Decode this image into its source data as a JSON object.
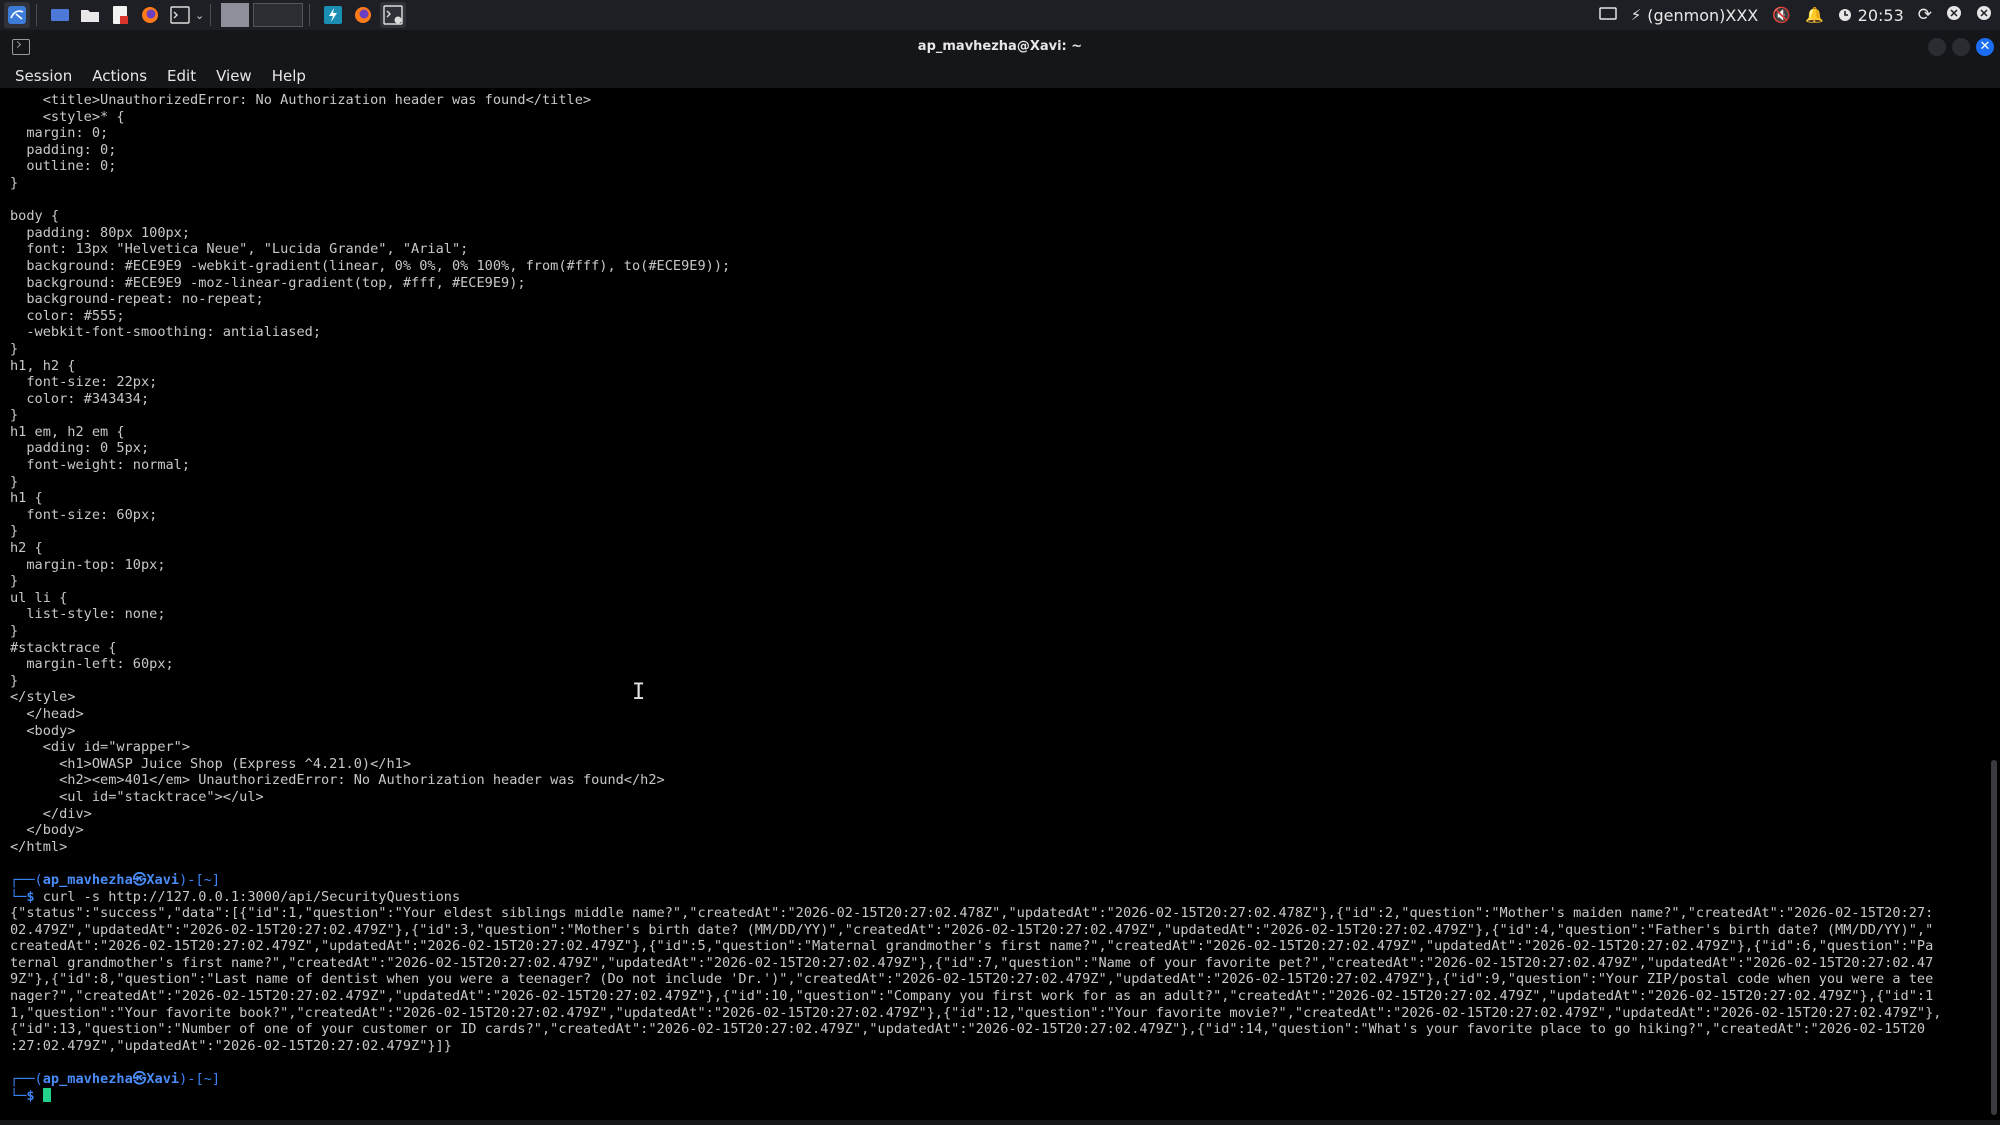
{
  "panel": {
    "status_label": "(genmon)XXX",
    "clock": "20:53"
  },
  "window": {
    "title": "ap_mavhezha@Xavi: ~"
  },
  "menu": [
    "Session",
    "Actions",
    "Edit",
    "View",
    "Help"
  ],
  "terminal": {
    "lines_before": [
      "    <title>UnauthorizedError: No Authorization header was found</title>",
      "    <style>* {",
      "  margin: 0;",
      "  padding: 0;",
      "  outline: 0;",
      "}",
      "",
      "body {",
      "  padding: 80px 100px;",
      "  font: 13px \"Helvetica Neue\", \"Lucida Grande\", \"Arial\";",
      "  background: #ECE9E9 -webkit-gradient(linear, 0% 0%, 0% 100%, from(#fff), to(#ECE9E9));",
      "  background: #ECE9E9 -moz-linear-gradient(top, #fff, #ECE9E9);",
      "  background-repeat: no-repeat;",
      "  color: #555;",
      "  -webkit-font-smoothing: antialiased;",
      "}",
      "h1, h2 {",
      "  font-size: 22px;",
      "  color: #343434;",
      "}",
      "h1 em, h2 em {",
      "  padding: 0 5px;",
      "  font-weight: normal;",
      "}",
      "h1 {",
      "  font-size: 60px;",
      "}",
      "h2 {",
      "  margin-top: 10px;",
      "}",
      "ul li {",
      "  list-style: none;",
      "}",
      "#stacktrace {",
      "  margin-left: 60px;",
      "}",
      "</style>",
      "  </head>",
      "  <body>",
      "    <div id=\"wrapper\">",
      "      <h1>OWASP Juice Shop (Express ^4.21.0)</h1>",
      "      <h2><em>401</em> UnauthorizedError: No Authorization header was found</h2>",
      "      <ul id=\"stacktrace\"></ul>",
      "    </div>",
      "  </body>",
      "</html>",
      ""
    ],
    "prompt1": {
      "open": "┌──(",
      "user": "ap_mavhezha㉿Xavi",
      "close": ")-[~]",
      "dollar": "└─$",
      "command": " curl -s http://127.0.0.1:3000/api/SecurityQuestions"
    },
    "output_lines": [
      "{\"status\":\"success\",\"data\":[{\"id\":1,\"question\":\"Your eldest siblings middle name?\",\"createdAt\":\"2026-02-15T20:27:02.478Z\",\"updatedAt\":\"2026-02-15T20:27:02.478Z\"},{\"id\":2,\"question\":\"Mother's maiden name?\",\"createdAt\":\"2026-02-15T20:27:",
      "02.479Z\",\"updatedAt\":\"2026-02-15T20:27:02.479Z\"},{\"id\":3,\"question\":\"Mother's birth date? (MM/DD/YY)\",\"createdAt\":\"2026-02-15T20:27:02.479Z\",\"updatedAt\":\"2026-02-15T20:27:02.479Z\"},{\"id\":4,\"question\":\"Father's birth date? (MM/DD/YY)\",\"",
      "createdAt\":\"2026-02-15T20:27:02.479Z\",\"updatedAt\":\"2026-02-15T20:27:02.479Z\"},{\"id\":5,\"question\":\"Maternal grandmother's first name?\",\"createdAt\":\"2026-02-15T20:27:02.479Z\",\"updatedAt\":\"2026-02-15T20:27:02.479Z\"},{\"id\":6,\"question\":\"Pa",
      "ternal grandmother's first name?\",\"createdAt\":\"2026-02-15T20:27:02.479Z\",\"updatedAt\":\"2026-02-15T20:27:02.479Z\"},{\"id\":7,\"question\":\"Name of your favorite pet?\",\"createdAt\":\"2026-02-15T20:27:02.479Z\",\"updatedAt\":\"2026-02-15T20:27:02.47",
      "9Z\"},{\"id\":8,\"question\":\"Last name of dentist when you were a teenager? (Do not include 'Dr.')\",\"createdAt\":\"2026-02-15T20:27:02.479Z\",\"updatedAt\":\"2026-02-15T20:27:02.479Z\"},{\"id\":9,\"question\":\"Your ZIP/postal code when you were a tee",
      "nager?\",\"createdAt\":\"2026-02-15T20:27:02.479Z\",\"updatedAt\":\"2026-02-15T20:27:02.479Z\"},{\"id\":10,\"question\":\"Company you first work for as an adult?\",\"createdAt\":\"2026-02-15T20:27:02.479Z\",\"updatedAt\":\"2026-02-15T20:27:02.479Z\"},{\"id\":1",
      "1,\"question\":\"Your favorite book?\",\"createdAt\":\"2026-02-15T20:27:02.479Z\",\"updatedAt\":\"2026-02-15T20:27:02.479Z\"},{\"id\":12,\"question\":\"Your favorite movie?\",\"createdAt\":\"2026-02-15T20:27:02.479Z\",\"updatedAt\":\"2026-02-15T20:27:02.479Z\"},",
      "{\"id\":13,\"question\":\"Number of one of your customer or ID cards?\",\"createdAt\":\"2026-02-15T20:27:02.479Z\",\"updatedAt\":\"2026-02-15T20:27:02.479Z\"},{\"id\":14,\"question\":\"What's your favorite place to go hiking?\",\"createdAt\":\"2026-02-15T20",
      ":27:02.479Z\",\"updatedAt\":\"2026-02-15T20:27:02.479Z\"}]}",
      ""
    ],
    "prompt2": {
      "open": "┌──(",
      "user": "ap_mavhezha㉿Xavi",
      "close": ")-[~]",
      "dollar": "└─$"
    }
  }
}
